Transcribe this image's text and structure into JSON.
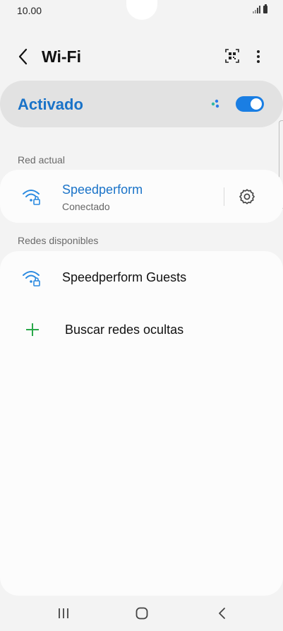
{
  "status": {
    "time": "10.00"
  },
  "header": {
    "title": "Wi-Fi"
  },
  "master": {
    "label": "Activado",
    "enabled": true,
    "accent": "#1a7ee3"
  },
  "current": {
    "section_label": "Red actual",
    "network": {
      "name": "Speedperform",
      "status": "Conectado"
    }
  },
  "available": {
    "section_label": "Redes disponibles",
    "networks": [
      {
        "name": "Speedperform Guests"
      }
    ],
    "add_hidden": "Buscar redes ocultas"
  }
}
